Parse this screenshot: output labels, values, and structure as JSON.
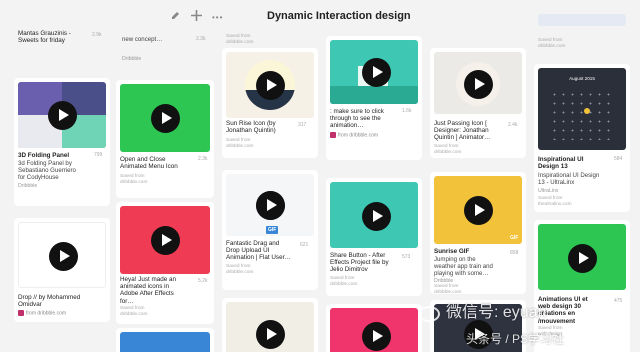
{
  "board": {
    "title": "Dynamic Interaction design",
    "toolbar": {
      "edit_icon": "pencil-icon",
      "move_icon": "move-arrows-icon",
      "more_label": "•••"
    }
  },
  "pins": {
    "c1_top": {
      "title": "Mantas Grauzinis -\nSweets for friday",
      "count": "2.9k"
    },
    "c1_a": {
      "title": "3D Folding Panel",
      "sub": "3d Folding Panel by\nSebastiano Guerriero\nfor CodyHouse",
      "src": "Dribbble",
      "count": "799"
    },
    "c1_b": {
      "title": "Drop // by Mohammed\nOmidvar",
      "from": "from dribbble.com"
    },
    "c2_top": {
      "sub": "new concept…",
      "src": "Dribbble",
      "count": "2.3k"
    },
    "c2_a": {
      "title": "Open and Close\nAnimated Menu Icon",
      "saved": "Saved from\ndribbble.com",
      "count": "2.3k"
    },
    "c2_b": {
      "title": "Heya! Just made an\nanimated icons in\nAdobe After Effects\nfor…",
      "saved": "Saved from\ndribbble.com",
      "count": "5.2k"
    },
    "c3_top": {
      "saved": "Saved from\ndribbble.com"
    },
    "c3_a": {
      "title": "Sun Rise Icon (by\nJonathan Quintin)",
      "saved": "Saved from\ndribbble.com",
      "count": "317"
    },
    "c3_b": {
      "title": "Fantastic Drag and\nDrop Upload UI\nAnimation | Flat User…",
      "saved": "Saved from\ndribbble.com",
      "count": "621",
      "gif": "GIF"
    },
    "c4_a": {
      "title": ": make sure to click\nthrough to see the\nanimation…",
      "from": "from dribbble.com",
      "count": "1.6k"
    },
    "c4_b": {
      "title": "Share Button - After\nEffects Project file by\nJelio Dimitrov",
      "saved": "Saved from\ndribbble.com",
      "count": "573"
    },
    "c5_a": {
      "title": "Just Passing Icon [\nDesigner: Jonathan\nQuintin ] Animator…",
      "saved": "Saved from\ndribbble.com",
      "count": "2.4k"
    },
    "c5_b": {
      "title": "Sunrise GIF",
      "sub": "Jumping on the\nweather app train and\nplaying with some…",
      "src": "Dribbble",
      "saved": "Saved from\ndribbble.com",
      "count": "858",
      "gif": "GIF"
    },
    "c6_top": {
      "saved": "Saved from\ndribbble.com"
    },
    "c6_a": {
      "title": "Inspirational UI\nDesign 13",
      "sub": "Inspirational UI Design\n13 - UltraLinx",
      "src": "UltraLinx",
      "saved": "Saved from\ntheultralinx.com",
      "count": "584",
      "calendar": "August 2015"
    },
    "c6_b": {
      "title": "Animations UI et\nweb design 30\ncréations en\n/mouvement",
      "saved": "Saved from\nweb design",
      "count": "475"
    }
  },
  "watermark": {
    "line1": "微信号: eyuan",
    "line2": "头条号 / PS学习社"
  },
  "colors": {
    "green": "#2dc652",
    "red": "#ef3b53",
    "teal": "#3ebea8",
    "yellow": "#f2c23b",
    "dark": "#2f3340",
    "purple_blue": "#5a5fa0"
  }
}
